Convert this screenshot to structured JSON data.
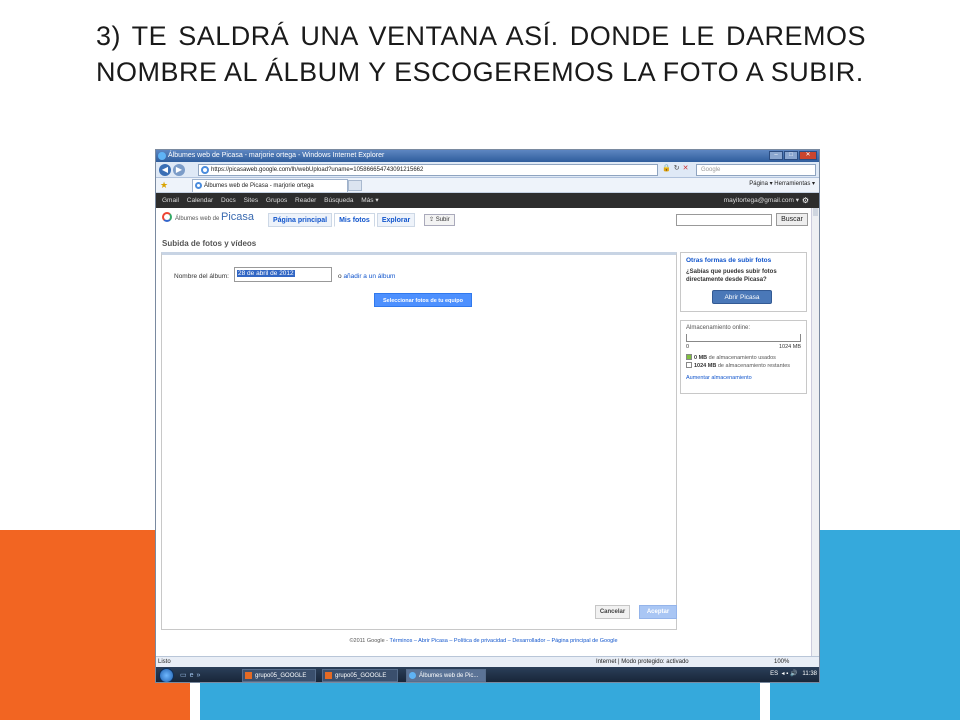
{
  "slide": {
    "title": "3) TE SALDRÁ UNA VENTANA ASÍ. DONDE LE DAREMOS NOMBRE AL ÁLBUM Y ESCOGEREMOS LA FOTO A SUBIR.",
    "colors": {
      "orange": "#f26522",
      "blue": "#35a9dc"
    }
  },
  "browser": {
    "window_title": "Álbumes web de Picasa - marjorie ortega - Windows Internet Explorer",
    "url": "https://picasaweb.google.com/lh/webUpload?uname=105866654743091215662",
    "search_placeholder": "Google",
    "tab_title": "Álbumes web de Picasa - marjorie ortega",
    "command_bar": "Página ▾  Herramientas ▾",
    "status_text": "Listo",
    "status_zone": "Internet | Modo protegido: activado",
    "zoom": "100%"
  },
  "google_bar": {
    "items": [
      "Gmail",
      "Calendar",
      "Docs",
      "Sites",
      "Grupos",
      "Reader",
      "Búsqueda",
      "Más ▾"
    ],
    "account": "mayitortega@gmail.com ▾"
  },
  "picasa": {
    "logo_small": "Álbumes web de",
    "logo_big": "Picasa",
    "tabs": [
      {
        "label": "Página principal"
      },
      {
        "label": "Mis fotos"
      },
      {
        "label": "Explorar"
      }
    ],
    "upload_label": "Subir",
    "search_button": "Buscar",
    "page_title": "Subida de fotos y vídeos"
  },
  "upload_form": {
    "album_label": "Nombre del álbum:",
    "album_value": "28 de abril de 2012",
    "or_text": "o",
    "add_to_album_link": "añadir a un álbum",
    "select_button": "Seleccionar fotos de tu equipo",
    "cancel_button": "Cancelar",
    "accept_button": "Aceptar"
  },
  "sidebar": {
    "other_ways": {
      "heading": "Otras formas de subir fotos",
      "text": "¿Sabías que puedes subir fotos directamente desde Picasa?",
      "button": "Abrir Picasa"
    },
    "storage": {
      "heading": "Almacenamiento online:",
      "scale_min": "0",
      "scale_max": "1024 MB",
      "used_value": "0 MB",
      "used_text": "de almacenamiento usados",
      "remaining_value": "1024 MB",
      "remaining_text": "de almacenamiento restantes",
      "increase_link": "Aumentar almacenamiento",
      "used_fraction": 0
    }
  },
  "footer": {
    "copyright": "©2011 Google",
    "links": "Términos – Abrir Picasa – Política de privacidad – Desarrollador – Página principal de Google"
  },
  "taskbar": {
    "buttons": [
      {
        "label": "grupo05_GOOGLE P..."
      },
      {
        "label": "grupo05_GOOGLE R..."
      },
      {
        "label": "Álbumes web de Pic..."
      }
    ],
    "lang": "ES",
    "time": "11:38"
  }
}
